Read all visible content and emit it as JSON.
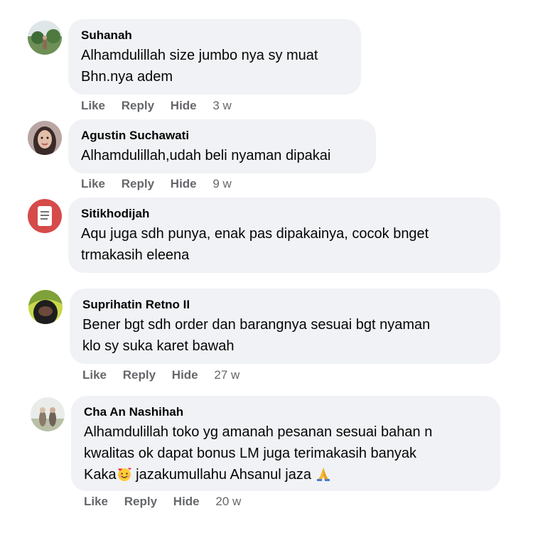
{
  "comments": [
    {
      "author": "Suhanah",
      "lines": [
        "Alhamdulillah size jumbo nya sy muat",
        "Bhn.nya adem"
      ],
      "like": "Like",
      "reply": "Reply",
      "hide": "Hide",
      "time": "3 w"
    },
    {
      "author": "Agustin Suchawati",
      "lines": [
        "Alhamdulillah,udah beli nyaman dipakai"
      ],
      "like": "Like",
      "reply": "Reply",
      "hide": "Hide",
      "time": "9 w"
    },
    {
      "author": "Sitikhodijah",
      "lines": [
        "Aqu juga sdh punya, enak pas dipakainya, cocok bnget",
        "trmakasih eleena"
      ]
    },
    {
      "author": "Suprihatin Retno II",
      "lines": [
        "Bener bgt sdh order dan barangnya sesuai bgt nyaman",
        "klo sy suka karet bawah"
      ],
      "like": "Like",
      "reply": "Reply",
      "hide": "Hide",
      "time": "27 w"
    },
    {
      "author": "Cha An Nashihah",
      "lines": [
        "Alhamdulillah toko yg amanah pesanan sesuai bahan n",
        "kwalitas ok dapat bonus LM juga terimakasih banyak"
      ],
      "line3_a": "Kaka",
      "line3_b": " jazakumullahu Ahsanul jaza ",
      "emoji_1": "smiling-face-with-hearts-icon",
      "emoji_2": "folded-hands-icon",
      "like": "Like",
      "reply": "Reply",
      "hide": "Hide",
      "time": "20 w"
    }
  ],
  "colors": {
    "bubble": "#f0f2f5",
    "text": "#050505",
    "meta": "#65676b"
  }
}
